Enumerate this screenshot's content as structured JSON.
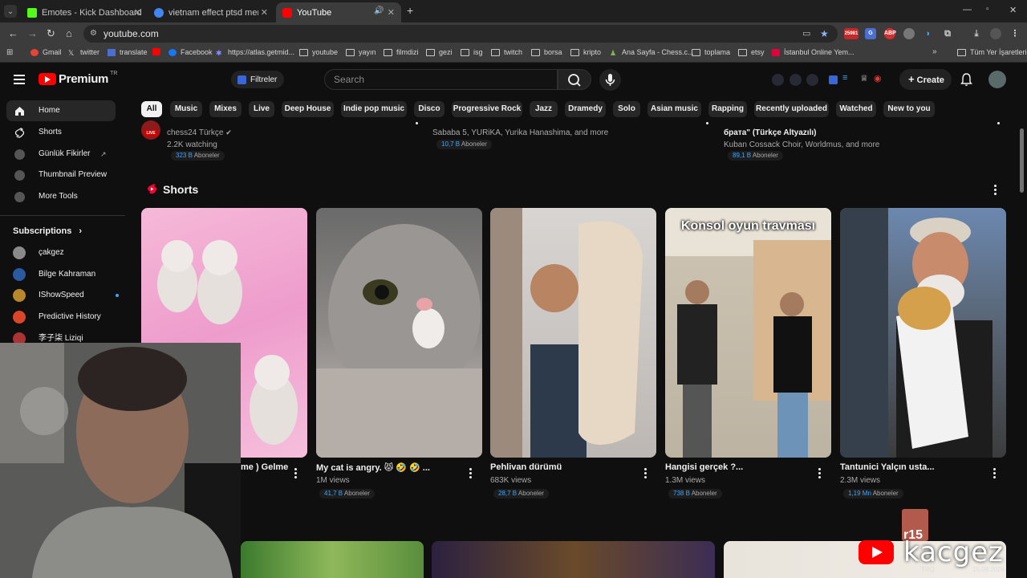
{
  "browser": {
    "tabs": [
      {
        "label": "Emotes - Kick Dashboard",
        "color": "#53fc18"
      },
      {
        "label": "vietnam effect ptsd meme - Go",
        "color": "#4285f4"
      },
      {
        "label": "YouTube",
        "color": "#ff0000"
      }
    ],
    "url": "youtube.com",
    "bookmarks": [
      {
        "label": "Gmail",
        "icon": "google-icon"
      },
      {
        "label": "twitter",
        "icon": "x-icon"
      },
      {
        "label": "translate",
        "icon": "translate-icon"
      },
      {
        "label": "",
        "icon": "youtube-icon"
      },
      {
        "label": "Facebook",
        "icon": "facebook-icon"
      },
      {
        "label": "https://atlas.getmid...",
        "icon": "atlas-icon"
      },
      {
        "label": "youtube",
        "icon": "folder-icon"
      },
      {
        "label": "yayın",
        "icon": "folder-icon"
      },
      {
        "label": "filmdizi",
        "icon": "folder-icon"
      },
      {
        "label": "gezi",
        "icon": "folder-icon"
      },
      {
        "label": "isg",
        "icon": "folder-icon"
      },
      {
        "label": "twitch",
        "icon": "folder-icon"
      },
      {
        "label": "borsa",
        "icon": "folder-icon"
      },
      {
        "label": "kripto",
        "icon": "folder-icon"
      },
      {
        "label": "Ana Sayfa - Chess.c...",
        "icon": "chess-icon"
      },
      {
        "label": "toplama",
        "icon": "folder-icon"
      },
      {
        "label": "etsy",
        "icon": "folder-icon"
      },
      {
        "label": "İstanbul Online Yem...",
        "icon": "yemek-icon"
      }
    ],
    "all_bookmarks": "Tüm Yer İşaretleri",
    "ext_badge": "25981"
  },
  "youtube": {
    "logo": "Premium",
    "logo_region": "TR",
    "filters_label": "Filtreler",
    "search_placeholder": "Search",
    "create_label": "Create",
    "chips": [
      "All",
      "Music",
      "Mixes",
      "Live",
      "Deep House",
      "Indie pop music",
      "Disco",
      "Progressive Rock",
      "Jazz",
      "Dramedy",
      "Solo",
      "Asian music",
      "Rapping",
      "Recently uploaded",
      "Watched",
      "New to you"
    ],
    "sidebar": {
      "items": [
        {
          "label": "Home",
          "icon": "home-icon"
        },
        {
          "label": "Shorts",
          "icon": "shorts-icon"
        },
        {
          "label": "Günlük Fikirler",
          "icon": "extension-icon"
        },
        {
          "label": "Thumbnail Preview",
          "icon": "extension-icon"
        },
        {
          "label": "More Tools",
          "icon": "extension-icon"
        }
      ],
      "subs_title": "Subscriptions",
      "subscriptions": [
        {
          "label": "çakgez",
          "color": "#8a8a8a"
        },
        {
          "label": "Bilge Kahraman",
          "color": "#2c5aa0"
        },
        {
          "label": "IShowSpeed",
          "color": "#b8862b"
        },
        {
          "label": "Predictive History",
          "color": "#d9462a"
        },
        {
          "label": "李子柒 Liziqi",
          "color": "#a33"
        }
      ]
    },
    "top_row": [
      {
        "line1": "chess24 Türkçe",
        "line2": "2.2K watching",
        "subs_num": "323 B",
        "subs_word": "Aboneler"
      },
      {
        "line1": "Sababa 5, YURiKA, Yurika Hanashima, and more",
        "subs_num": "10,7 B",
        "subs_word": "Aboneler"
      },
      {
        "line0": "брата\" (Türkçe Altyazılı)",
        "line1": "Kuban Cossack Choir, Worldmus, and more",
        "subs_num": "89,1 B",
        "subs_word": "Aboneler"
      }
    ],
    "live_badge": "LIVE",
    "shorts_title": "Shorts",
    "shorts": [
      {
        "title": "me ) Gelme",
        "views": "",
        "subs_num": "",
        "subs_word": ""
      },
      {
        "title": "My cat is angry. 😾 🤣 🤣 ...",
        "views": "1M views",
        "subs_num": "41,7 B",
        "subs_word": "Aboneler"
      },
      {
        "title": "Pehlivan dürümü",
        "views": "683K views",
        "subs_num": "28,7 B",
        "subs_word": "Aboneler"
      },
      {
        "title": "Hangisi gerçek ?...",
        "views": "1.3M views",
        "subs_num": "738 B",
        "subs_word": "Aboneler",
        "overlay": "Konsol oyun travması"
      },
      {
        "title": "Tantunici Yalçın usta...",
        "views": "2.3M views",
        "subs_num": "1,19 Mn",
        "subs_word": "Aboneler"
      }
    ]
  },
  "overlay": {
    "channel": "kacgez",
    "badge": "r15",
    "trq": "TRQ",
    "date": "15.08.2026"
  }
}
